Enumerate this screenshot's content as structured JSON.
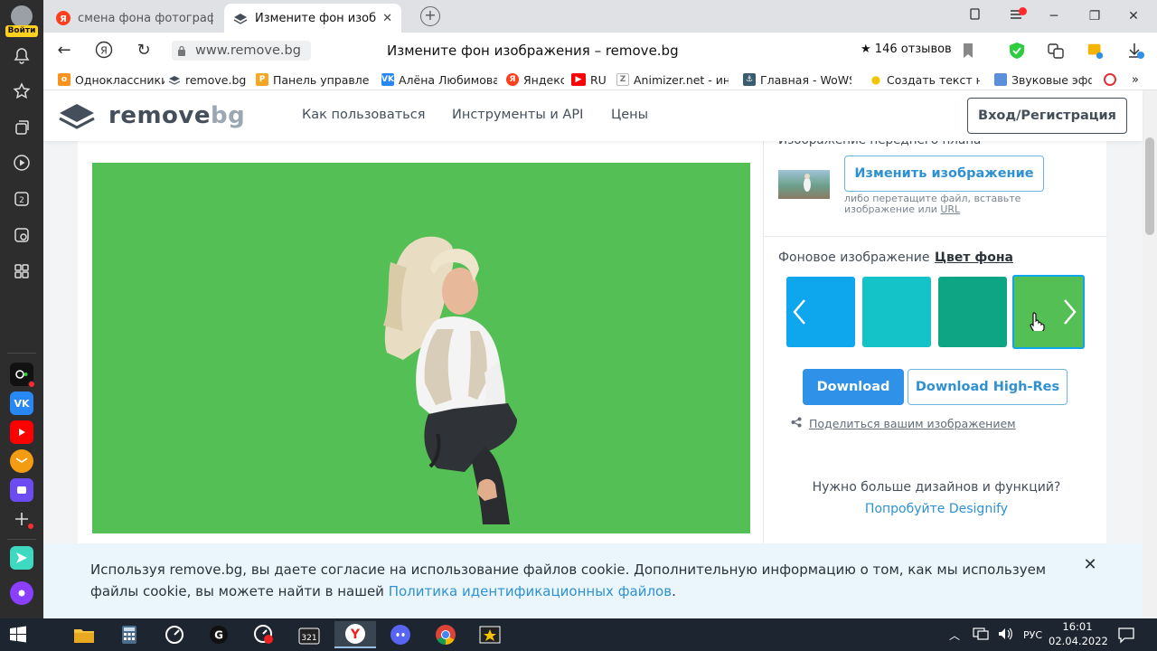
{
  "sidebar": {
    "login_label": "Войти"
  },
  "tabs": [
    {
      "title": "смена фона фотографии"
    },
    {
      "title": "Измените фон изображения"
    }
  ],
  "address": {
    "url": "www.remove.bg",
    "page_title": "Измените фон изображения – remove.bg",
    "reviews": "146 отзывов"
  },
  "bookmarks": [
    {
      "label": "Одноклассники",
      "icon": "odnoklassniki-icon",
      "color": "#f7931e"
    },
    {
      "label": "remove.bg",
      "icon": "removebg-icon",
      "color": "#454f5b"
    },
    {
      "label": "Панель управлен",
      "icon": "panel-icon",
      "color": "#f5a623"
    },
    {
      "label": "Алёна Любимова",
      "icon": "vk-icon",
      "color": "#2787f5"
    },
    {
      "label": "Яндекс",
      "icon": "yandex-icon",
      "color": "#fc3f1d"
    },
    {
      "label": "RU",
      "icon": "youtube-icon",
      "color": "#ff0000"
    },
    {
      "label": "Animizer.net - инс",
      "icon": "animizer-icon",
      "color": "#888888"
    },
    {
      "label": "Главная - WoWS",
      "icon": "wows-icon",
      "color": "#3b5b6e"
    },
    {
      "label": "Создать текст на",
      "icon": "sun-icon",
      "color": "#f5c400"
    },
    {
      "label": "Звуковые эффе",
      "icon": "sound-icon",
      "color": "#5b8fd9"
    }
  ],
  "site": {
    "logo_main": "remove",
    "logo_accent": "bg",
    "nav": [
      "Как пользоваться",
      "Инструменты и API",
      "Цены"
    ],
    "login_button": "Вход/Регистрация"
  },
  "editor": {
    "fg_label": "Изображение переднего плана",
    "change_image": "Изменить изображение",
    "drop_hint": "либо перетащите файл, вставьте изображение или",
    "drop_hint_link": "URL",
    "tab_bg_image": "Фоновое изображение",
    "tab_bg_color": "Цвет фона",
    "swatches": [
      "#0ea6ec",
      "#14c3c8",
      "#0ea585",
      "#53bf55"
    ],
    "selected_color": "#53bf55",
    "download": "Download",
    "download_hr": "Download High-Res",
    "share": "Поделиться вашим изображением",
    "more_text": "Нужно больше дизайнов и функций?",
    "more_link": "Попробуйте Designify"
  },
  "cookie": {
    "text": "Используя remove.bg, вы даете согласие на использование файлов cookie. Дополнительную информацию о том, как мы используем файлы cookie, вы можете найти в нашей",
    "link": "Политика идентификационных файлов",
    "end": "."
  },
  "taskbar": {
    "lang": "РУС",
    "time": "16:01",
    "date": "02.04.2022"
  }
}
